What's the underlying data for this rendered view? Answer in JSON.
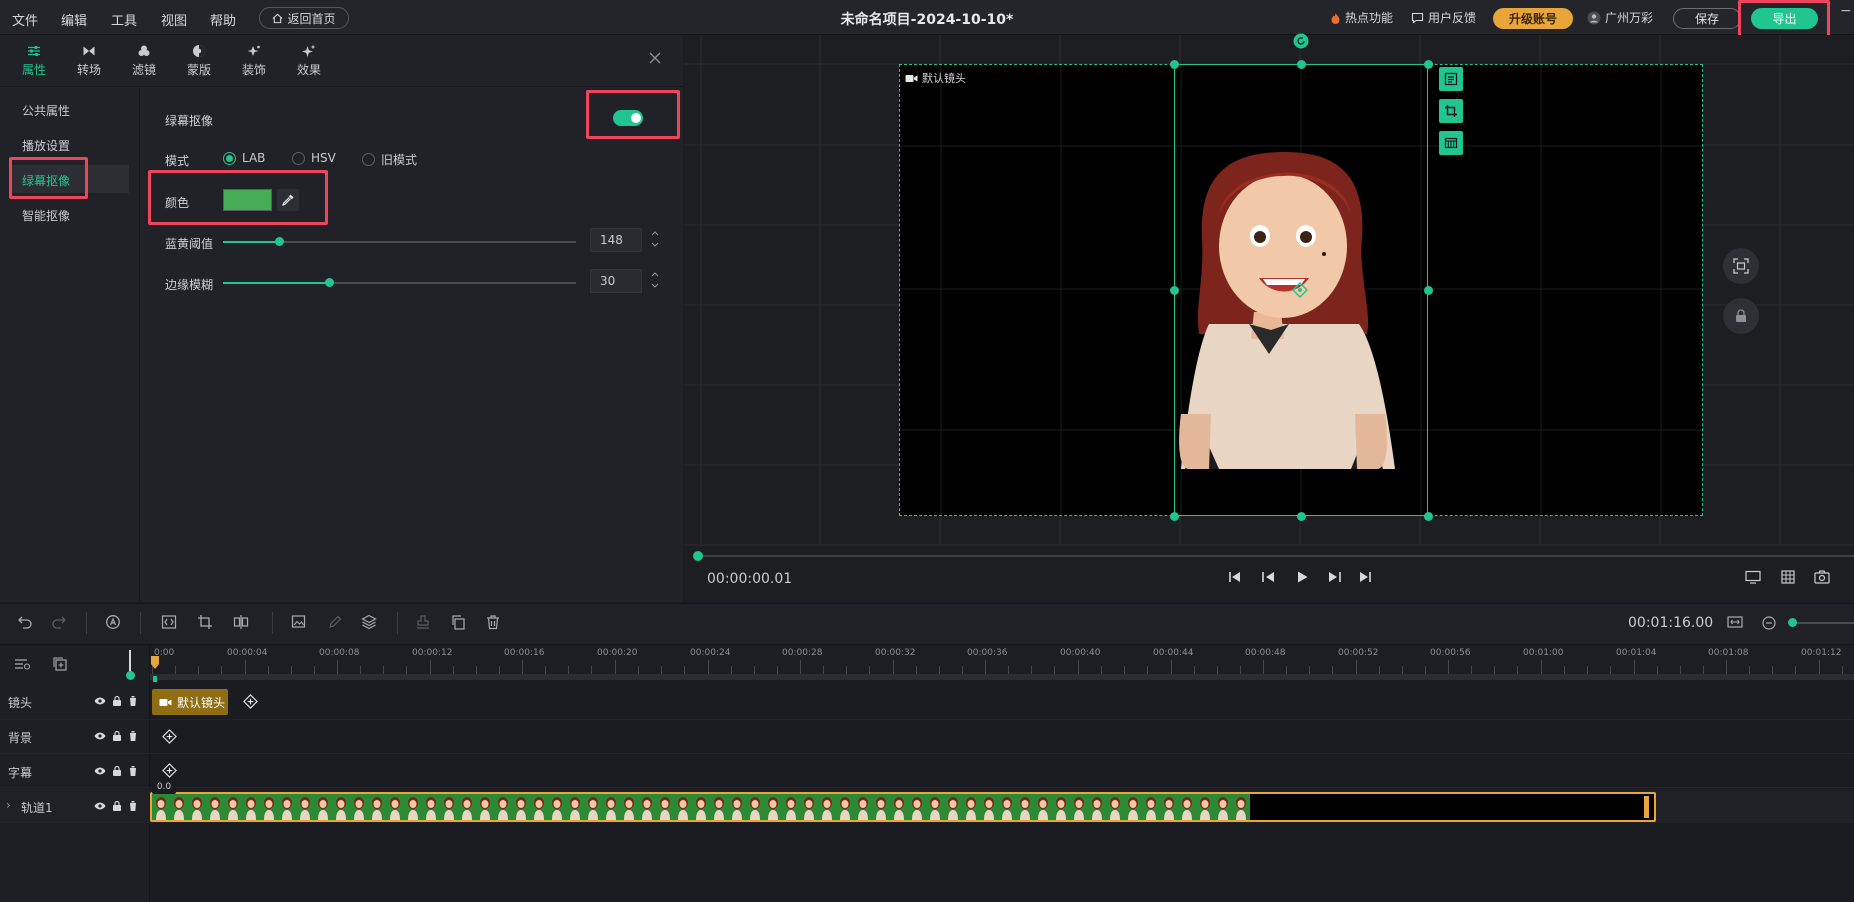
{
  "menu": [
    "文件",
    "编辑",
    "工具",
    "视图",
    "帮助"
  ],
  "home_button": "返回首页",
  "project_title": "未命名项目-2024-10-10*",
  "header_links": {
    "hot": "热点功能",
    "feedback": "用户反馈"
  },
  "upgrade_label": "升级账号",
  "user_name": "广州万彩",
  "save_label": "保存",
  "export_label": "导出",
  "tabs": [
    "属性",
    "转场",
    "滤镜",
    "蒙版",
    "装饰",
    "效果"
  ],
  "side_nav": [
    "公共属性",
    "播放设置",
    "绿幕抠像",
    "智能抠像"
  ],
  "keying": {
    "title": "绿幕抠像",
    "enabled": true,
    "mode_label": "模式",
    "modes": [
      "LAB",
      "HSV",
      "旧模式"
    ],
    "selected_mode": "LAB",
    "color_label": "颜色",
    "key_color": "#46ad56",
    "threshold_label": "蓝黄阈值",
    "threshold_value": "148",
    "blur_label": "边缘模糊",
    "blur_value": "30"
  },
  "preview": {
    "camera_label": "默认镜头",
    "current_time": "00:00:00.01",
    "total_time": "00:01:16.00"
  },
  "ruler_ticks": [
    "0:00",
    "00:00:04",
    "00:00:08",
    "00:00:12",
    "00:00:16",
    "00:00:20",
    "00:00:24",
    "00:00:28",
    "00:00:32",
    "00:00:36",
    "00:00:40",
    "00:00:44",
    "00:00:48",
    "00:00:52",
    "00:00:56",
    "00:01:00",
    "00:01:04",
    "00:01:08",
    "00:01:12"
  ],
  "tracks": [
    "镜头",
    "背景",
    "字幕",
    "轨道1"
  ],
  "camera_clip_label": "默认镜头",
  "clip_badge": "0.0",
  "colors": {
    "accent": "#20c58f",
    "highlight": "#f0445c",
    "upgrade": "#e8a63a",
    "clip": "#8e6d13"
  }
}
